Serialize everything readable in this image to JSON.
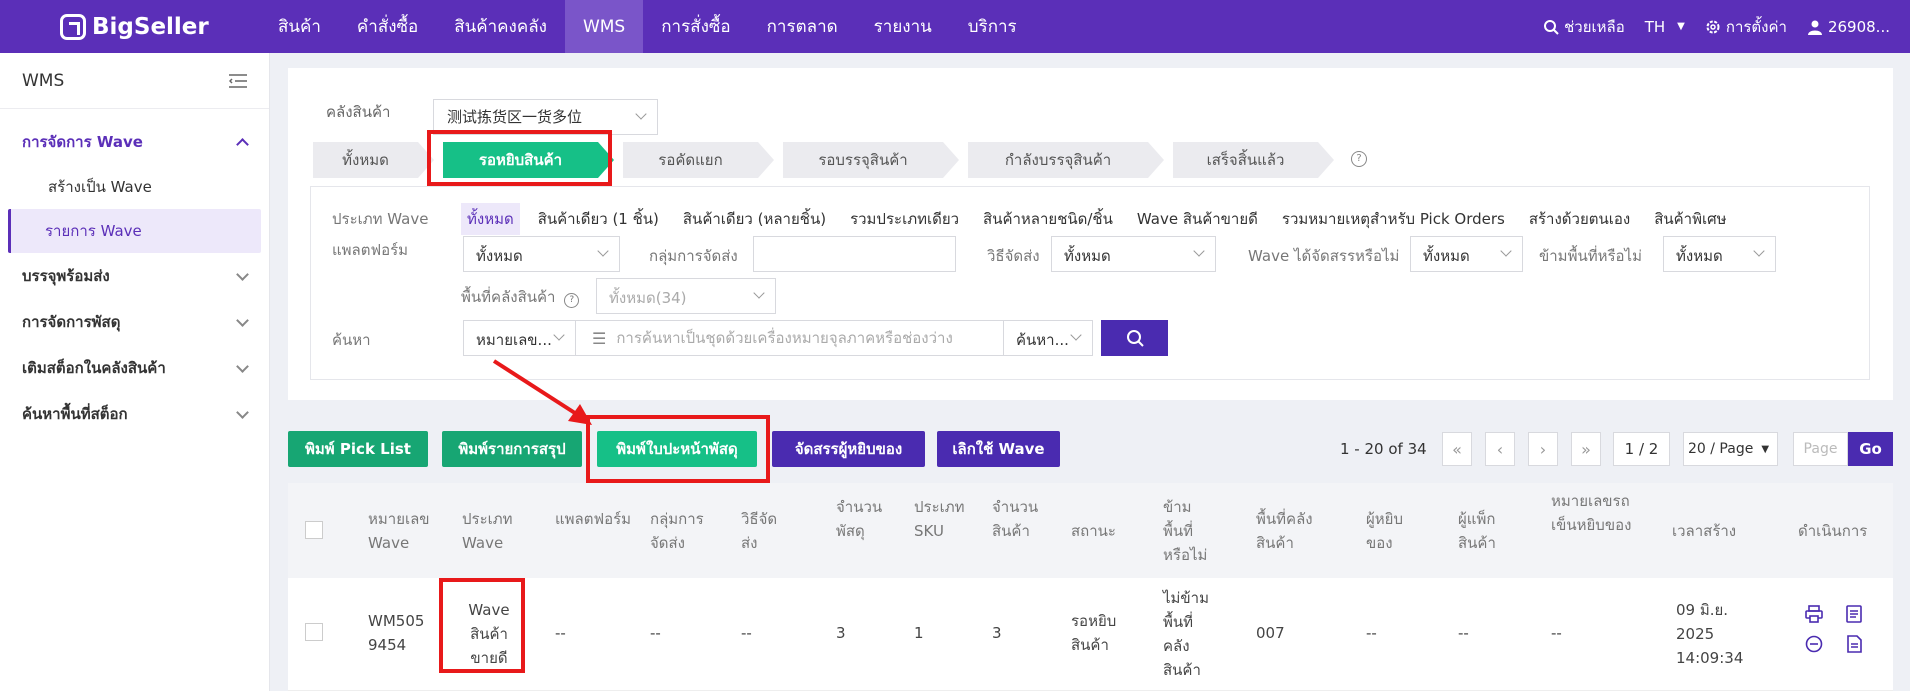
{
  "brand": {
    "name": "BigSeller"
  },
  "nav": {
    "items": [
      "สินค้า",
      "คำสั่งซื้อ",
      "สินค้าคงคลัง",
      "WMS",
      "การสั่งซื้อ",
      "การตลาด",
      "รายงาน",
      "บริการ"
    ],
    "active": "WMS",
    "help": "ช่วยเหลือ",
    "lang": "TH",
    "settings": "การตั้งค่า",
    "user": "26908..."
  },
  "sidebar": {
    "title": "WMS",
    "groups": [
      {
        "label": "การจัดการ Wave",
        "open": true,
        "subs": [
          "สร้างเป็น Wave",
          "รายการ Wave"
        ]
      },
      {
        "label": "บรรจุพร้อมส่ง"
      },
      {
        "label": "การจัดการพัสดุ"
      },
      {
        "label": "เติมสต็อกในคลังสินค้า"
      },
      {
        "label": "ค้นหาพื้นที่สต็อก"
      }
    ]
  },
  "warehouse": {
    "label": "คลังสินค้า",
    "value": "测试拣货区一货多位"
  },
  "steps": [
    "ทั้งหมด",
    "รอหยิบสินค้า",
    "รอคัดแยก",
    "รอบรรจุสินค้า",
    "กำลังบรรจุสินค้า",
    "เสร็จสิ้นแล้ว"
  ],
  "filters": {
    "wave_type_label": "ประเภท Wave",
    "wave_types": [
      "ทั้งหมด",
      "สินค้าเดียว (1 ชิ้น)",
      "สินค้าเดียว (หลายชิ้น)",
      "รวมประเภทเดียว",
      "สินค้าหลายชนิด/ชิ้น",
      "Wave สินค้าขายดี",
      "รวมหมายเหตุสำหรับ Pick Orders",
      "สร้างด้วยตนเอง",
      "สินค้าพิเศษ"
    ],
    "platform_label": "แพลตฟอร์ม",
    "platform_value": "ทั้งหมด",
    "shipping_group_label": "กลุ่มการจัดส่ง",
    "shipping_method_label": "วิธีจัดส่ง",
    "shipping_method_value": "ทั้งหมด",
    "picker_assigned_label": "Wave ได้จัดสรรหรือไม่",
    "picker_assigned_value": "ทั้งหมด",
    "skip_area_label": "ข้ามพื้นที่หรือไม่",
    "skip_area_value": "ทั้งหมด",
    "area_label": "พื้นที่คลังสินค้า",
    "area_value": "ทั้งหมด(34)",
    "search_label": "ค้นหา",
    "search_field": "หมายเลข...",
    "search_placeholder": "การค้นหาเป็นชุดด้วยเครื่องหมายจุลภาคหรือช่องว่าง",
    "search_mode": "ค้นหา..."
  },
  "actions": {
    "print_pick_list": "พิมพ์ Pick List",
    "print_summary": "พิมพ์รายการสรุป",
    "print_label": "พิมพ์ใบปะหน้าพัสดุ",
    "assign_picker": "จัดสรรผู้หยิบของ",
    "cancel_wave": "เลิกใช้ Wave"
  },
  "pagination": {
    "range": "1 - 20 of 34",
    "page": "1 / 2",
    "per_page": "20 / Page",
    "page_placeholder": "Page",
    "go": "Go"
  },
  "table": {
    "headers": [
      "หมายเลข Wave",
      "ประเภท Wave",
      "แพลตฟอร์ม",
      "กลุ่มการจัดส่ง",
      "วิธีจัดส่ง",
      "จำนวนพัสดุ",
      "ประเภท SKU",
      "จำนวนสินค้า",
      "สถานะ",
      "ข้ามพื้นที่หรือไม่",
      "พื้นที่คลังสินค้า",
      "ผู้หยิบของ",
      "ผู้แพ็กสินค้า",
      "หมายเลขรถเข็นหยิบของ",
      "เวลาสร้าง",
      "ดำเนินการ"
    ],
    "rows": [
      {
        "wave_no": "WM5059454",
        "wave_type": "Wave สินค้าขายดี",
        "platform": "--",
        "shipping_group": "--",
        "shipping_method": "--",
        "parcels": "3",
        "sku_types": "1",
        "qty": "3",
        "status": "รอหยิบสินค้า",
        "skip_area": "ไม่ข้ามพื้นที่คลังสินค้า",
        "area": "007",
        "picker": "--",
        "packer": "--",
        "cart_no": "--",
        "created": "09 มิ.ย. 2025 14:09:34"
      }
    ]
  },
  "colors": {
    "brand": "#5b2fb8",
    "green": "#16c087",
    "action_purple": "#4a2bb0",
    "annotation": "#e8191a"
  }
}
